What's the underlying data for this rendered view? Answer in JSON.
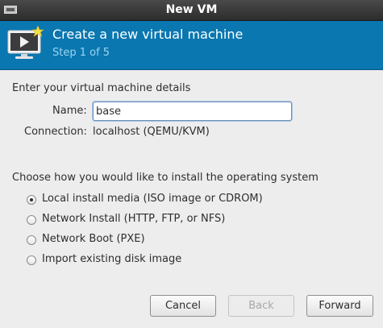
{
  "window": {
    "title": "New VM"
  },
  "banner": {
    "heading": "Create a new virtual machine",
    "step": "Step 1 of 5"
  },
  "details": {
    "section_label": "Enter your virtual machine details",
    "name_label": "Name:",
    "name_value": "base",
    "connection_label": "Connection:",
    "connection_value": "localhost (QEMU/KVM)"
  },
  "install": {
    "section_label": "Choose how you would like to install the operating system",
    "options": [
      {
        "label": "Local install media (ISO image or CDROM)",
        "checked": true
      },
      {
        "label": "Network Install (HTTP, FTP, or NFS)",
        "checked": false
      },
      {
        "label": "Network Boot (PXE)",
        "checked": false
      },
      {
        "label": "Import existing disk image",
        "checked": false
      }
    ]
  },
  "buttons": {
    "cancel": "Cancel",
    "back": "Back",
    "forward": "Forward",
    "back_enabled": false
  },
  "colors": {
    "banner": "#0a77b0",
    "step_text": "#9ed4f2",
    "titlebar": "#333333"
  }
}
